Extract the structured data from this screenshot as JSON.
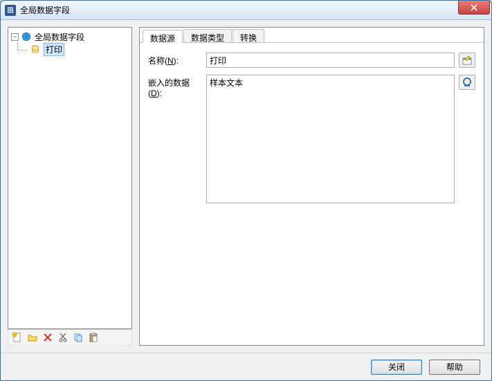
{
  "window": {
    "title": "全局数据字段"
  },
  "tree": {
    "root": {
      "label": "全局数据字段"
    },
    "child": {
      "label": "打印"
    }
  },
  "toolbar": {
    "new": "new",
    "folder": "folder",
    "delete": "delete",
    "cut": "cut",
    "copy": "copy",
    "paste": "paste"
  },
  "tabs": {
    "data_source": "数据源",
    "data_type": "数据类型",
    "transform": "转换"
  },
  "form": {
    "name_label_pre": "名称(",
    "name_label_key": "N",
    "name_label_post": "):",
    "name_value": "打印",
    "embed_label_pre": "嵌入的数据(",
    "embed_label_key": "D",
    "embed_label_post": "):",
    "embed_value": "样本文本"
  },
  "buttons": {
    "close": "关闭",
    "help": "帮助"
  }
}
